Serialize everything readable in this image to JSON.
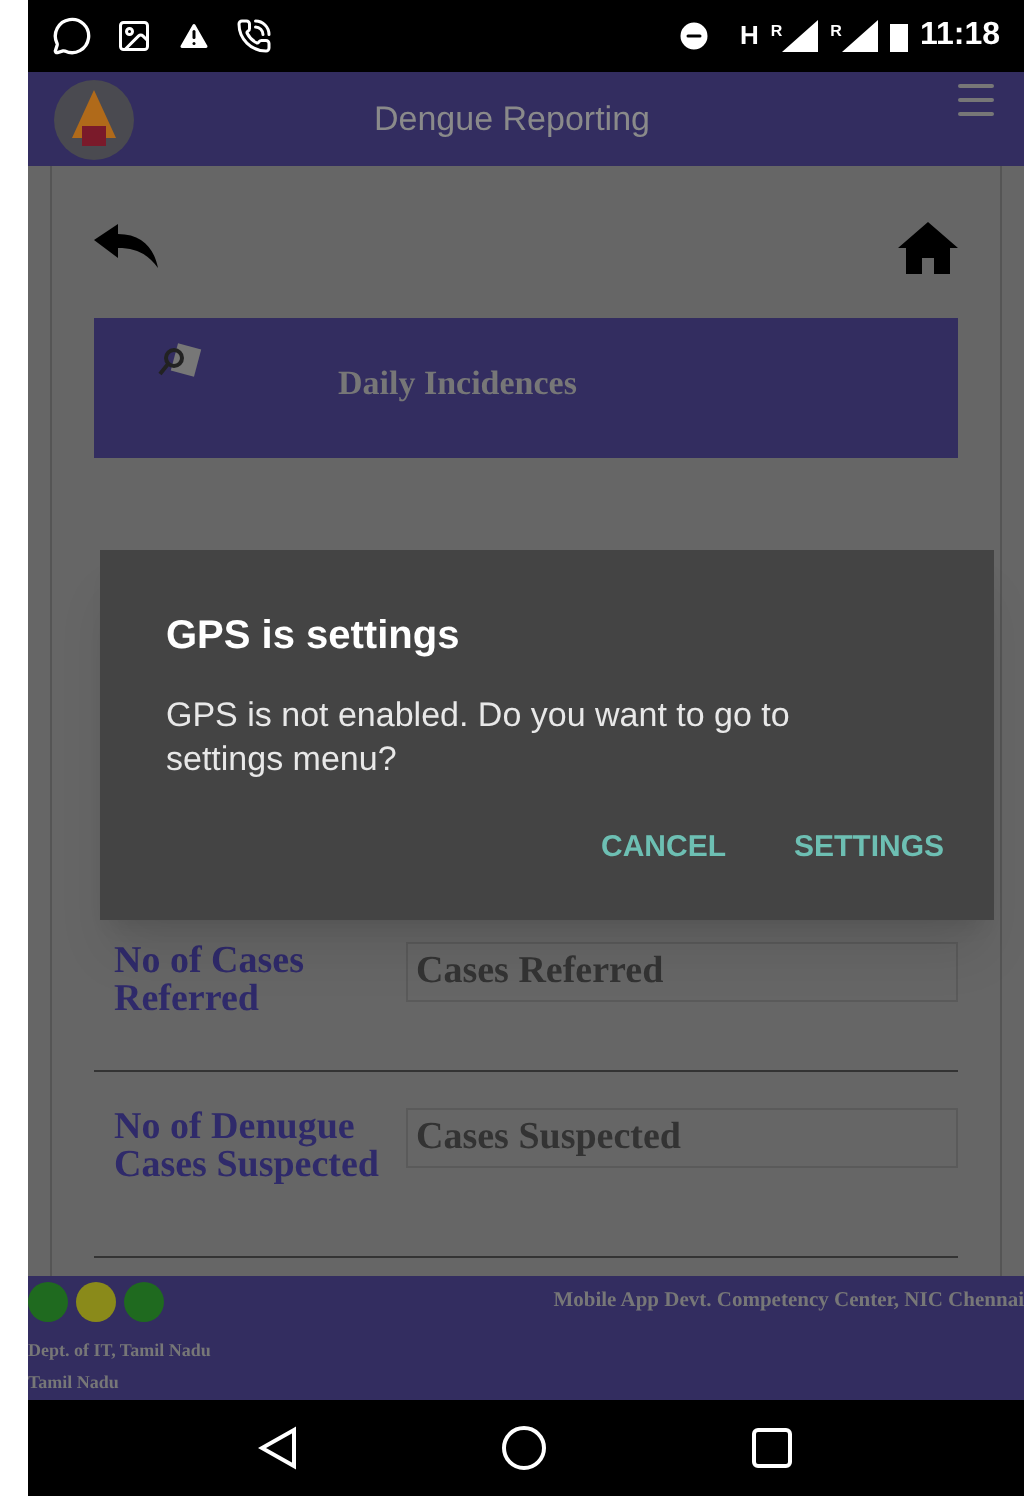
{
  "status_bar": {
    "network_letter": "H",
    "roaming": [
      "R",
      "R"
    ],
    "time": "11:18"
  },
  "app_bar": {
    "title": "Dengue Reporting"
  },
  "banner": {
    "title": "Daily Incidences"
  },
  "form": {
    "rows": [
      {
        "label": "No of Cases Referred",
        "placeholder": "Cases Referred"
      },
      {
        "label": "No of Denugue Cases Suspected",
        "placeholder": "Cases Suspected"
      }
    ]
  },
  "dialog": {
    "title": "GPS is settings",
    "message": "GPS is not enabled. Do you want to go to settings menu?",
    "buttons": [
      "CANCEL",
      "SETTINGS"
    ]
  },
  "footer": {
    "dots": [
      {
        "color": "#1f6a1f"
      },
      {
        "color": "#8a8a1a"
      },
      {
        "color": "#1f6a1f"
      }
    ],
    "credit": "Mobile App Devt. Competency Center, NIC Chennai",
    "lines": [
      "Dept. of IT, Tamil Nadu",
      "Tamil Nadu"
    ]
  }
}
